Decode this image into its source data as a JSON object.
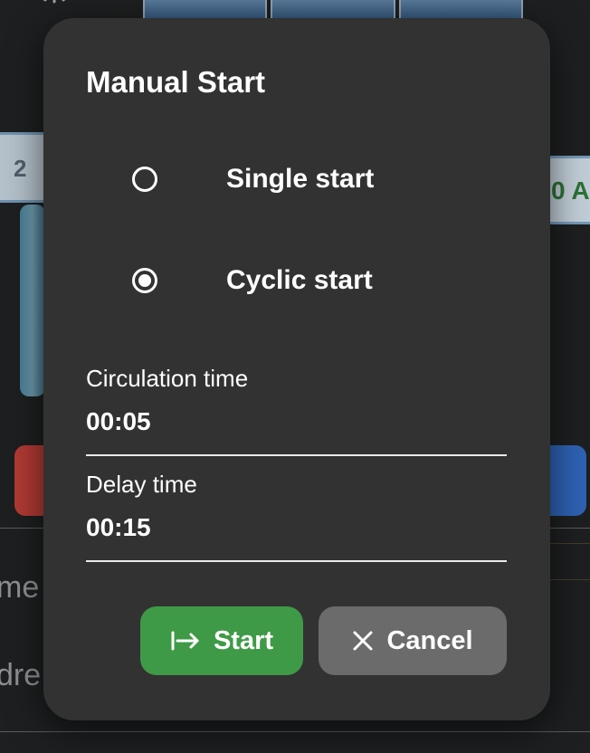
{
  "background": {
    "left_chip_value": "2",
    "right_chip_value": "0 A",
    "left_text_1": "me",
    "left_text_2": "dre"
  },
  "dialog": {
    "title": "Manual Start",
    "options": [
      {
        "label": "Single start",
        "selected": false
      },
      {
        "label": "Cyclic start",
        "selected": true
      }
    ],
    "fields": {
      "circulation_time": {
        "label": "Circulation time",
        "value": "00:05"
      },
      "delay_time": {
        "label": "Delay time",
        "value": "00:15"
      }
    },
    "buttons": {
      "start": {
        "label": "Start",
        "icon": "arrow-right-to-bar-icon"
      },
      "cancel": {
        "label": "Cancel",
        "icon": "close-icon"
      }
    }
  },
  "colors": {
    "dialog_bg": "#323232",
    "start_button": "#3f9a47",
    "cancel_button": "#6b6b6b"
  }
}
